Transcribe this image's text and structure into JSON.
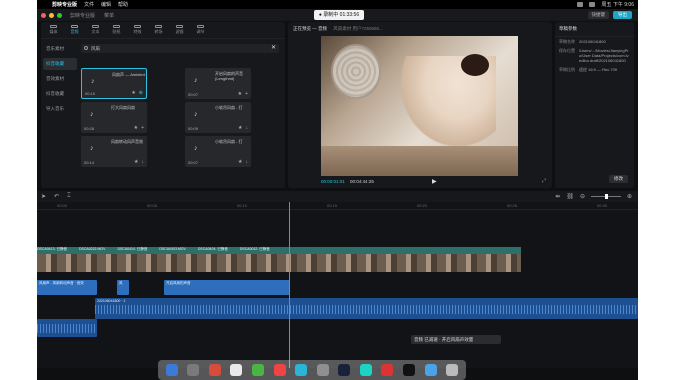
{
  "menubar": {
    "app_name": "剪映专业版",
    "items": [
      "文件",
      "编辑",
      "帮助"
    ],
    "clock": "周五 下午 9:06"
  },
  "titlebar": {
    "menu_items": [
      "剪映专业版",
      "菜单"
    ],
    "recording": "● 录制中 01:33:56",
    "shortcut": "快捷键",
    "export": "导出"
  },
  "media": {
    "tools": [
      "媒体",
      "音频",
      "文本",
      "贴纸",
      "特效",
      "转场",
      "滤镜",
      "调节"
    ],
    "sidebar": [
      "音乐素材",
      "抖音收藏",
      "音效素材",
      "抖音收藏",
      "导入音乐"
    ],
    "search_value": "风扇",
    "cards": [
      {
        "title": "风扇声 — Ambient",
        "duration": "00:15"
      },
      {
        "title": "开启风扇的声音 (Lengthmt)",
        "duration": "00:07"
      },
      {
        "title": "打大风扇风扇",
        "duration": "00:28"
      },
      {
        "title": "小软吊风扇 - 打",
        "duration": "00:09"
      },
      {
        "title": "风扇转动风声音效",
        "duration": "00:14"
      },
      {
        "title": "小软吊风扇 - 打",
        "duration": "00:07"
      }
    ],
    "player": {
      "name": "风扇声 — 用户7250686...",
      "time": "00:00"
    }
  },
  "preview": {
    "title": "正在预览 — 音频",
    "subtitle": "风扇素材 用户7250686...",
    "current_time": "00:00:01:01",
    "total_time": "00:04:44:25",
    "play": "▶",
    "full": "⤢"
  },
  "props": {
    "header": "草稿参数",
    "rows": [
      {
        "k": "草稿名称",
        "v": "202106041800"
      },
      {
        "k": "保存位置",
        "v": "/Users/.../Movies/JianyingPro/User Data/Projects/com.lveditor.draft/202106041800"
      },
      {
        "k": "草稿比例",
        "v": "适应 16:9 — Rec.709"
      }
    ],
    "modify": "修改"
  },
  "timeline": {
    "ruler": [
      "00:00",
      "00:05",
      "00:10",
      "00:15",
      "00:20",
      "00:25",
      "00:30",
      "00:35",
      "00:40",
      "00:45"
    ],
    "video_labels": [
      "DSCA0413. 已静音",
      "DSCA0222.MOV",
      "DSCA0414. 已静音",
      "DSCA0403.MOV",
      "DSCA0404. 已静音",
      "DSCA0012. 已静音"
    ],
    "audio1_label": "风扇声 - 风扇转动声音 · 音效",
    "audio2_label": "风",
    "audio3_label": "开启风扇的声音",
    "music_label": "202106041800 · 1",
    "toast": "音频 已减速 · 开启风扇声效量"
  },
  "colors": {
    "accent": "#2ac3e0",
    "video_track": "#2c6f6b",
    "audio_track": "#2d6fbd"
  }
}
